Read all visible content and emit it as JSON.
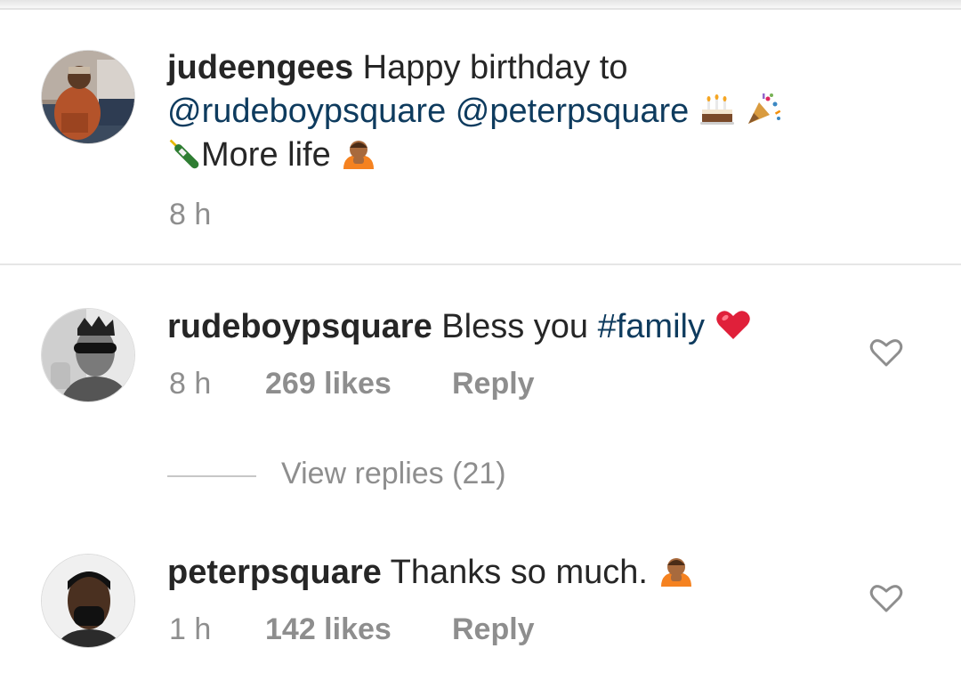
{
  "comments": [
    {
      "username": "judeengees",
      "text_parts": {
        "intro": "Happy birthday to",
        "mention1": "@rudeboypsquare",
        "mention2": "@peterpsquare",
        "line3": "More life"
      },
      "emojis": [
        "birthday-cake",
        "party-popper",
        "champagne-bottle",
        "person-bowing"
      ],
      "time": "8 h"
    },
    {
      "username": "rudeboypsquare",
      "text_parts": {
        "text": "Bless you",
        "hashtag": "#family"
      },
      "emojis": [
        "red-heart"
      ],
      "time": "8 h",
      "likes": "269 likes",
      "reply": "Reply",
      "view_replies": "View replies (21)"
    },
    {
      "username": "peterpsquare",
      "text_parts": {
        "text": "Thanks so much."
      },
      "emojis": [
        "person-bowing"
      ],
      "time": "1 h",
      "likes": "142 likes",
      "reply": "Reply"
    }
  ],
  "colors": {
    "link": "#0e3b5e",
    "meta": "#8e8e8e",
    "text": "#262626"
  }
}
